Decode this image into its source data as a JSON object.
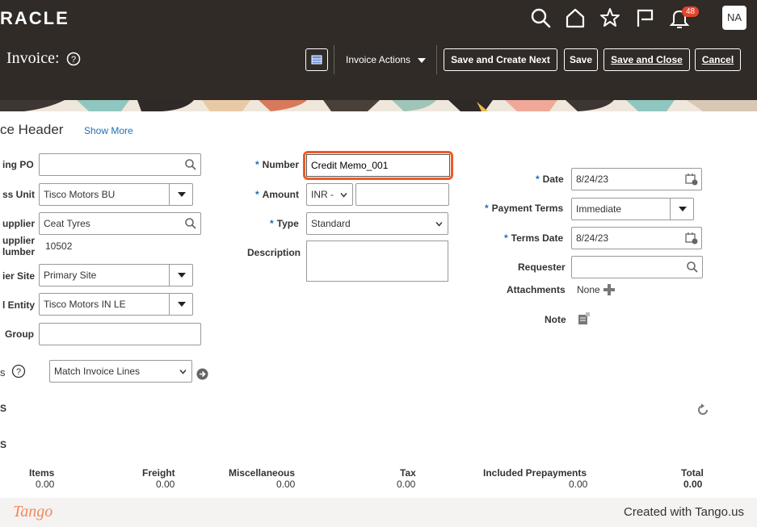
{
  "header": {
    "logo": "RACLE",
    "notification_count": "48",
    "avatar": "NA",
    "page_title": "Invoice:",
    "invoice_actions": "Invoice Actions",
    "save_and_create_next": "Save and Create Next",
    "save": "Save",
    "save_and_close": "Save and Close",
    "cancel": "Cancel"
  },
  "section": {
    "title": "ce Header",
    "show_more": "Show More"
  },
  "left_col": {
    "po_label": "ing PO",
    "bu_label": "ss Unit",
    "bu_value": "Tisco Motors BU",
    "supplier_label": "upplier",
    "supplier_value": "Ceat Tyres",
    "supplier_num_label_1": "upplier",
    "supplier_num_label_2": "lumber",
    "supplier_num_value": "10502",
    "site_label": "ier Site",
    "site_value": "Primary Site",
    "entity_label": "l Entity",
    "entity_value": "Tisco Motors IN LE",
    "group_label": "Group",
    "match_label": "s",
    "match_value": "Match Invoice Lines",
    "s1": "S",
    "s2": "S"
  },
  "mid_col": {
    "number_label": "Number",
    "number_value": "Credit Memo_001",
    "amount_label": "Amount",
    "currency": "INR -",
    "type_label": "Type",
    "type_value": "Standard",
    "description_label": "Description"
  },
  "right_col": {
    "date_label": "Date",
    "date_value": "8/24/23",
    "terms_label": "Payment Terms",
    "terms_value": "Immediate",
    "terms_date_label": "Terms Date",
    "terms_date_value": "8/24/23",
    "requester_label": "Requester",
    "attachments_label": "Attachments",
    "attachments_value": "None",
    "note_label": "Note"
  },
  "totals": [
    {
      "label": "Items",
      "value": "0.00"
    },
    {
      "label": "Freight",
      "value": "0.00"
    },
    {
      "label": "Miscellaneous",
      "value": "0.00"
    },
    {
      "label": "Tax",
      "value": "0.00"
    },
    {
      "label": "Included Prepayments",
      "value": "0.00"
    },
    {
      "label": "Total",
      "value": "0.00"
    }
  ],
  "footer": {
    "brand": "Tango",
    "created": "Created with Tango.us"
  }
}
